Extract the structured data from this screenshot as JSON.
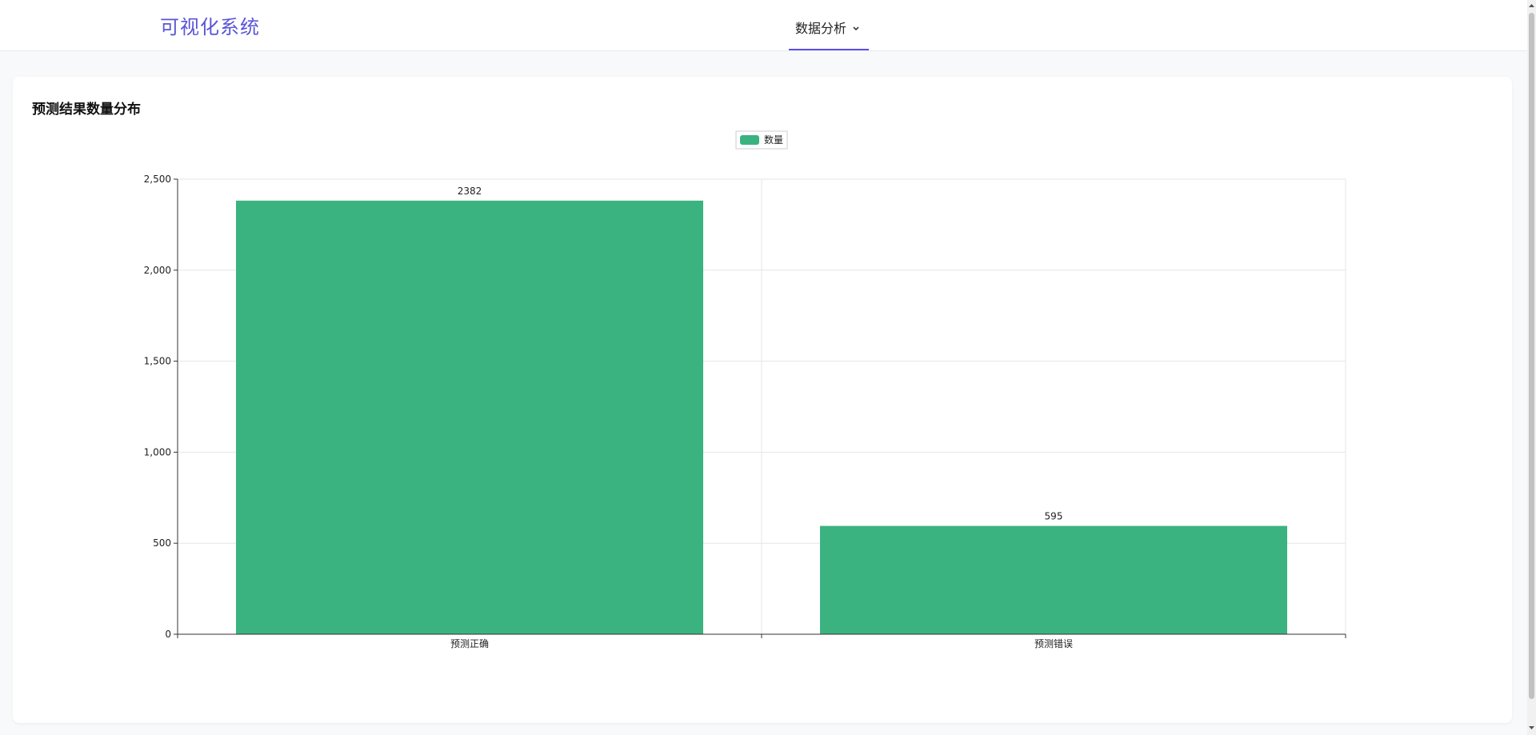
{
  "header": {
    "brand": "可视化系统",
    "nav_label": "数据分析"
  },
  "card": {
    "title": "预测结果数量分布"
  },
  "colors": {
    "brand": "#5b55d6",
    "bar": "#3ab380",
    "nav_underline": "#5b4fe6"
  },
  "icons": {
    "nav_dropdown": "chevron-down-icon"
  },
  "chart_data": {
    "type": "bar",
    "categories": [
      "预测正确",
      "预测错误"
    ],
    "series": [
      {
        "name": "数量",
        "values": [
          2382,
          595
        ]
      }
    ],
    "data_labels": [
      "2382",
      "595"
    ],
    "yticks": [
      "0",
      "500",
      "1,000",
      "1,500",
      "2,000",
      "2,500"
    ],
    "ylim": [
      0,
      2500
    ],
    "grid": true,
    "legend_position": "top-center"
  }
}
